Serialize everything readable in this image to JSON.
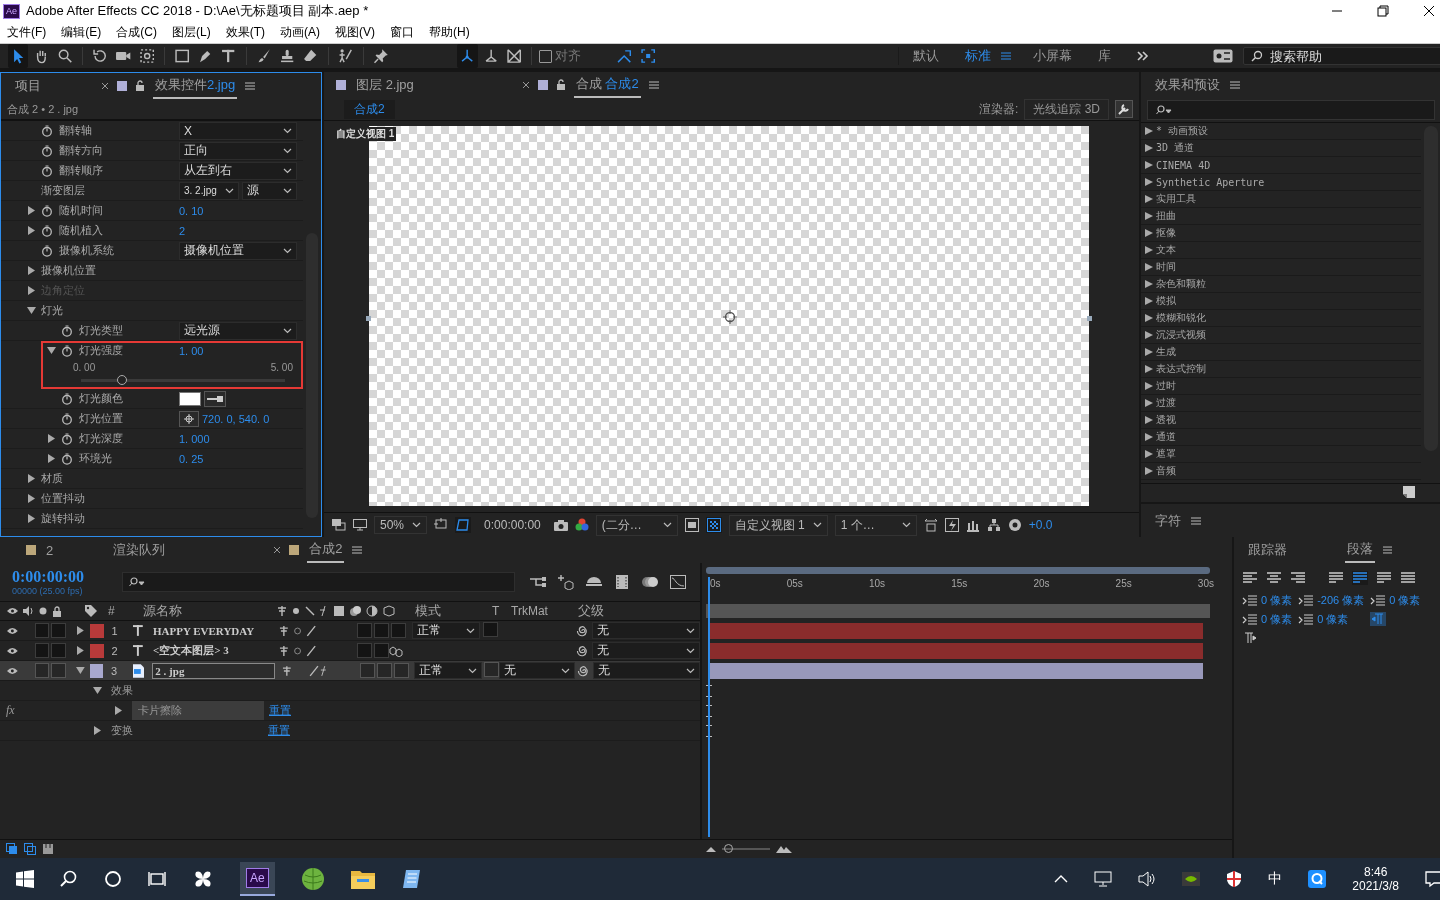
{
  "window": {
    "title": "Adobe After Effects CC 2018 - D:\\Ae\\无标题项目 副本.aep *",
    "app_badge": "Ae"
  },
  "menu": [
    "文件(F)",
    "编辑(E)",
    "合成(C)",
    "图层(L)",
    "效果(T)",
    "动画(A)",
    "视图(V)",
    "窗口",
    "帮助(H)"
  ],
  "tools": [
    {
      "selected": true
    },
    {
      "selected": false
    },
    {
      "selected": false
    },
    {
      "selected": false
    },
    {
      "selected": false
    },
    {
      "selected": false
    },
    {
      "selected": false
    },
    {
      "selected": false
    },
    {
      "selected": false
    },
    {
      "selected": false
    },
    {
      "selected": false
    },
    {
      "selected": false
    },
    {
      "selected": false
    },
    {
      "selected": false
    }
  ],
  "axis_modes": [
    {
      "selected": true
    },
    {
      "selected": false
    },
    {
      "selected": false
    }
  ],
  "snap": {
    "label": "对齐",
    "checked": false
  },
  "workspaces": [
    {
      "label": "默认",
      "selected": false
    },
    {
      "label": "标准",
      "selected": true
    },
    {
      "label": "小屏幕",
      "selected": false
    },
    {
      "label": "库",
      "selected": false
    }
  ],
  "help_search": {
    "placeholder": "搜索帮助"
  },
  "effect_controls": {
    "tabs": [
      {
        "label": "项目",
        "selected": false
      },
      {
        "label": "效果控件",
        "target": "2.jpg",
        "selected": true
      }
    ],
    "breadcrumb": "合成 2 • 2 . jpg",
    "rows": [
      {
        "label": "翻转轴",
        "kind": "dropdown",
        "animatable": true,
        "value": "X"
      },
      {
        "label": "翻转方向",
        "kind": "dropdown",
        "animatable": true,
        "value": "正向"
      },
      {
        "label": "翻转顺序",
        "kind": "dropdown",
        "animatable": true,
        "value": "从左到右"
      },
      {
        "label": "渐变图层",
        "kind": "dual_dropdown",
        "animatable": false,
        "values": [
          "3. 2.jpg",
          "源"
        ]
      },
      {
        "label": "随机时间",
        "kind": "number",
        "animatable": true,
        "expanded": false,
        "value": "0. 10"
      },
      {
        "label": "随机植入",
        "kind": "number",
        "animatable": true,
        "expanded": false,
        "value": "2"
      },
      {
        "label": "摄像机系统",
        "kind": "dropdown",
        "animatable": true,
        "value": "摄像机位置"
      },
      {
        "label": "摄像机位置",
        "kind": "group",
        "animatable": false,
        "expanded": false,
        "disabled": false
      },
      {
        "label": "边角定位",
        "kind": "group",
        "animatable": false,
        "expanded": false,
        "disabled": true
      },
      {
        "label": "灯光",
        "kind": "group",
        "animatable": false,
        "expanded": true,
        "disabled": false,
        "children": [
          {
            "label": "灯光类型",
            "kind": "dropdown",
            "animatable": true,
            "value": "远光源"
          },
          {
            "label": "灯光强度",
            "kind": "slider",
            "animatable": true,
            "expanded": true,
            "highlighted": true,
            "value": "1. 00",
            "min": "0. 00",
            "max": "5. 00",
            "level": 0.2
          },
          {
            "label": "灯光颜色",
            "kind": "color",
            "animatable": true,
            "color": "#ffffff"
          },
          {
            "label": "灯光位置",
            "kind": "point",
            "animatable": true,
            "value": "720. 0, 540. 0"
          },
          {
            "label": "灯光深度",
            "kind": "number",
            "animatable": true,
            "expanded": false,
            "value": "1. 000"
          },
          {
            "label": "环境光",
            "kind": "number",
            "animatable": true,
            "expanded": false,
            "value": "0. 25"
          }
        ]
      },
      {
        "label": "材质",
        "kind": "group",
        "animatable": false,
        "expanded": false,
        "disabled": false
      },
      {
        "label": "位置抖动",
        "kind": "group",
        "animatable": false,
        "expanded": false,
        "disabled": false
      },
      {
        "label": "旋转抖动",
        "kind": "group",
        "animatable": false,
        "expanded": false,
        "disabled": false
      }
    ]
  },
  "viewer": {
    "tabs": [
      {
        "label": "图层",
        "target": "2.jpg",
        "selected": false
      },
      {
        "label": "合成",
        "target": "合成2",
        "selected": true
      }
    ],
    "comp_chip": "合成2",
    "renderer_label": "渲染器:",
    "renderer": "光线追踪 3D",
    "view_label": "自定义视图 1",
    "zoom": "50%",
    "timecode": "0:00:00:00",
    "resolution": "(二分…",
    "view": "自定义视图 1",
    "views_count": "1 个…",
    "exposure": "+0.0"
  },
  "effects_presets": {
    "title": "效果和预设",
    "categories": [
      "* 动画预设",
      "3D 通道",
      "CINEMA 4D",
      "Synthetic Aperture",
      "实用工具",
      "扭曲",
      "抠像",
      "文本",
      "时间",
      "杂色和颗粒",
      "模拟",
      "模糊和锐化",
      "沉浸式视频",
      "生成",
      "表达式控制",
      "过时",
      "过渡",
      "透视",
      "通道",
      "遮罩",
      "音频"
    ]
  },
  "character": {
    "title": "字符"
  },
  "timeline": {
    "tabs": [
      {
        "label": "2",
        "selected": false
      },
      {
        "label": "渲染队列",
        "selected": false
      },
      {
        "label": "合成2",
        "selected": true
      }
    ],
    "timecode": "0:00:00:00",
    "frame_info": "00000 (25.00 fps)",
    "columns": {
      "number": "#",
      "source": "源名称",
      "mode": "模式",
      "t": "T",
      "trkmat": "TrkMat",
      "parent": "父级"
    },
    "zoom": {
      "level": 0.05
    },
    "ruler": [
      "0s",
      "05s",
      "10s",
      "15s",
      "20s",
      "25s",
      "30s"
    ],
    "layers": [
      {
        "number": "1",
        "kind": "text",
        "name": "HAPPY EVERYDAY",
        "color": "#b83a3a",
        "selected": false,
        "expanded": false,
        "mode": "正常",
        "parent": "无"
      },
      {
        "number": "2",
        "kind": "text",
        "name": "<空文本图层> 3",
        "color": "#b83a3a",
        "selected": false,
        "expanded": false,
        "parent": "无"
      },
      {
        "number": "3",
        "kind": "image",
        "name": "2 . jpg",
        "color": "#a9a9cf",
        "selected": true,
        "expanded": true,
        "mode": "正常",
        "trkmat": "无",
        "parent": "无",
        "children": [
          {
            "label": "效果",
            "expanded": true,
            "children": [
              {
                "label": "卡片擦除",
                "expanded": false,
                "action": "重置",
                "badge": "fx"
              }
            ]
          },
          {
            "label": "变换",
            "expanded": false,
            "action": "重置"
          }
        ]
      }
    ]
  },
  "paragraph": {
    "tabs": [
      {
        "label": "跟踪器",
        "selected": false
      },
      {
        "label": "段落",
        "selected": true
      }
    ],
    "indents": [
      "0 像素",
      "-206 像素",
      "0 像素",
      "0 像素",
      "0 像素"
    ]
  },
  "taskbar": {
    "ae_badge": "Ae",
    "ime": "中",
    "time": "8:46",
    "date": "2021/3/8"
  }
}
